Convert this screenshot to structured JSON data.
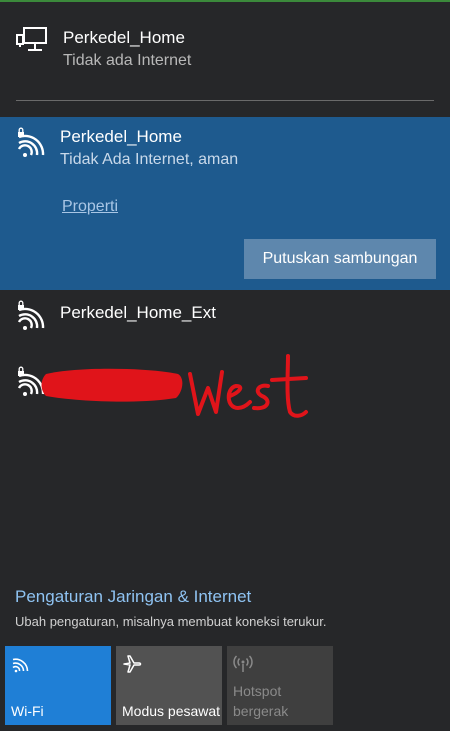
{
  "ethernet": {
    "icon": "ethernet-icon",
    "name": "Perkedel_Home",
    "status": "Tidak ada Internet"
  },
  "selected_network": {
    "icon": "secured-wifi-icon",
    "name": "Perkedel_Home",
    "status": "Tidak Ada Internet, aman",
    "properties_link": "Properti",
    "disconnect_button": "Putuskan sambungan",
    "highlight_color": "#1e5a8e"
  },
  "networks": [
    {
      "icon": "secured-wifi-icon",
      "name": "Perkedel_Home_Ext"
    },
    {
      "icon": "secured-wifi-icon",
      "name_visible_part": "West",
      "redacted": true
    }
  ],
  "settings": {
    "link": "Pengaturan Jaringan & Internet",
    "description": "Ubah pengaturan, misalnya membuat koneksi terukur."
  },
  "quick_actions": [
    {
      "icon": "wifi-icon",
      "label": "Wi-Fi",
      "active": true,
      "color": "#1f7fd6"
    },
    {
      "icon": "airplane-icon",
      "label": "Modus pesawat",
      "active": false,
      "color": "#525252"
    },
    {
      "icon": "hotspot-icon",
      "label": "Hotspot bergerak",
      "active": false,
      "disabled": true,
      "color": "#3f3f3f"
    }
  ]
}
